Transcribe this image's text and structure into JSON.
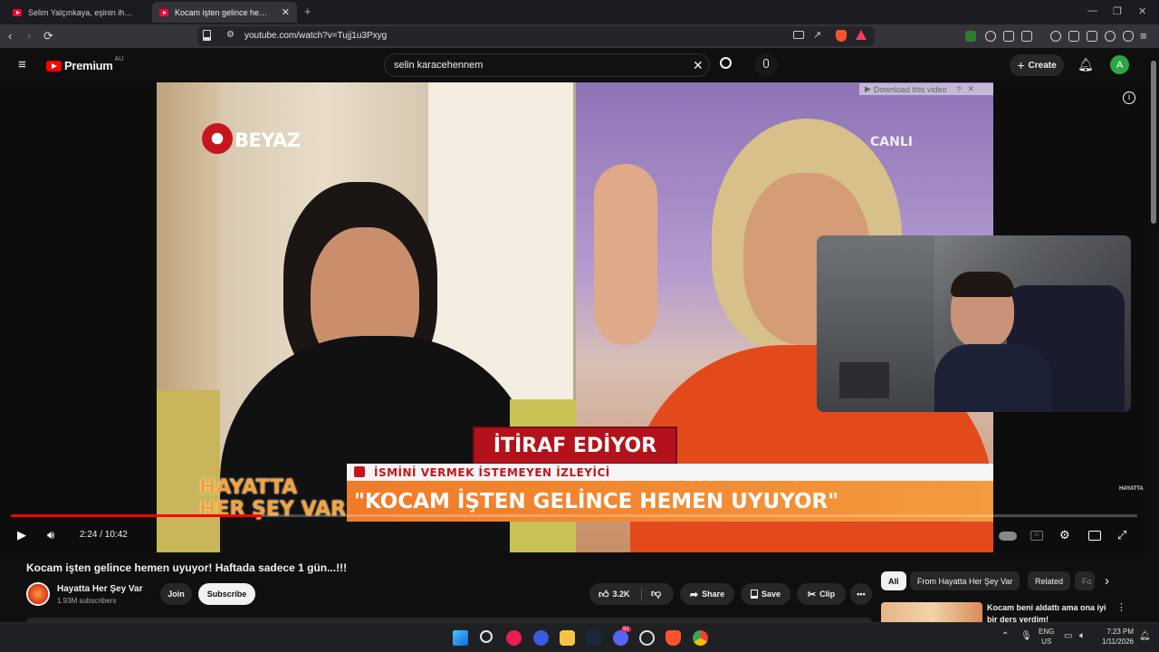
{
  "browser": {
    "tabs": [
      {
        "label": "Selim Yalçınkaya, eşinin ihanet mesaj",
        "active": false
      },
      {
        "label": "Kocam işten gelince hemen uyu",
        "active": true
      }
    ],
    "new_tab": "+",
    "url": "youtube.com/watch?v=Tujj1u3Pxyg"
  },
  "youtube": {
    "logo_label": "Premium",
    "logo_region": "AU",
    "search_value": "selin karacehennem",
    "create_label": "Create",
    "avatar_letter": "A"
  },
  "video": {
    "overlay_download": "Download this video",
    "overlay_help": "?",
    "channel_logo": "BEYAZ",
    "live_label": "CANLI",
    "banner_top": "İTİRAF EDİYOR",
    "banner_sub": "İSMİNİ VERMEK İSTEMEYEN İZLEYİCİ",
    "banner_main": "\"KOCAM İŞTEN GELİNCE HEMEN UYUYOR\"",
    "show_name_1": "HAYATTA",
    "show_name_2": "HER ŞEY VAR",
    "watermark": "HAYATTA",
    "time": "2:24 / 10:42",
    "progress_fraction": 0.2228
  },
  "details": {
    "title": "Kocam işten gelince hemen uyuyor! Haftada sadece 1 gün...!!!",
    "channel": "Hayatta Her Şey Var",
    "subscribers": "1.93M subscribers",
    "join": "Join",
    "subscribe": "Subscribe",
    "likes": "3.2K",
    "share": "Share",
    "save": "Save",
    "clip": "Clip"
  },
  "sidebar": {
    "chips": [
      "All",
      "From Hayatta Her Şey Var",
      "Related",
      "Fo"
    ],
    "rec_title": "Kocam beni aldattı ama ona iyi bir ders verdim!"
  },
  "taskbar": {
    "lang": "ENG",
    "region": "US",
    "time": "7:23 PM",
    "date": "1/11/2026",
    "discord_badge": "91"
  },
  "colors": {
    "yt_red": "#ff0000",
    "accent_green": "#2ba640"
  }
}
